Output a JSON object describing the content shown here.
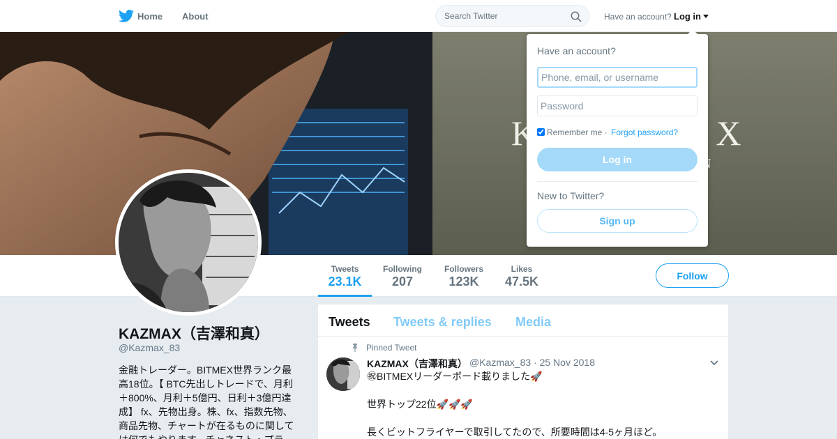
{
  "nav": {
    "logo_icon": "twitter-bird-icon",
    "home": "Home",
    "about": "About",
    "search_placeholder": "Search Twitter",
    "have_account": "Have an account?",
    "login": "Log in"
  },
  "banner": {
    "brand_text": "KAZMAX",
    "brand_sub": "N"
  },
  "profile_nav": {
    "stats": [
      {
        "label": "Tweets",
        "value": "23.1K",
        "active": true
      },
      {
        "label": "Following",
        "value": "207"
      },
      {
        "label": "Followers",
        "value": "123K"
      },
      {
        "label": "Likes",
        "value": "47.5K"
      }
    ],
    "follow": "Follow"
  },
  "profile": {
    "name": "KAZMAX（吉澤和真）",
    "handle": "@Kazmax_83",
    "bio": "金融トレーダー。BITMEX世界ランク最高18位。【 BTC先出しトレードで、月利＋800%、月利＋5億円、日利＋3億円達成】 fx、先物出身。株、fx、指数先物、商品先物、チャートが在るものに関しては何でもやります。チャネスト・プラ"
  },
  "timeline": {
    "tabs": [
      "Tweets",
      "Tweets & replies",
      "Media"
    ],
    "pinned_label": "Pinned Tweet",
    "tweet": {
      "name": "KAZMAX（吉澤和真）",
      "meta": "@Kazmax_83 · 25 Nov 2018",
      "text": "㊗BITMEXリーダーボード載りました🚀\n\n世界トップ22位🚀🚀🚀\n\n長くビットフライヤーで取引してたので、所要時間は4-5ヶ月ほど。"
    }
  },
  "login_dropdown": {
    "title": "Have an account?",
    "username_placeholder": "Phone, email, or username",
    "password_placeholder": "Password",
    "remember": "Remember me",
    "separator": " · ",
    "forgot": "Forgot password?",
    "login_button": "Log in",
    "new_to": "New to Twitter?",
    "signup_button": "Sign up"
  },
  "colors": {
    "accent": "#1da1f2",
    "accent_light": "#a4d9f9",
    "background": "#e6ecf0"
  }
}
